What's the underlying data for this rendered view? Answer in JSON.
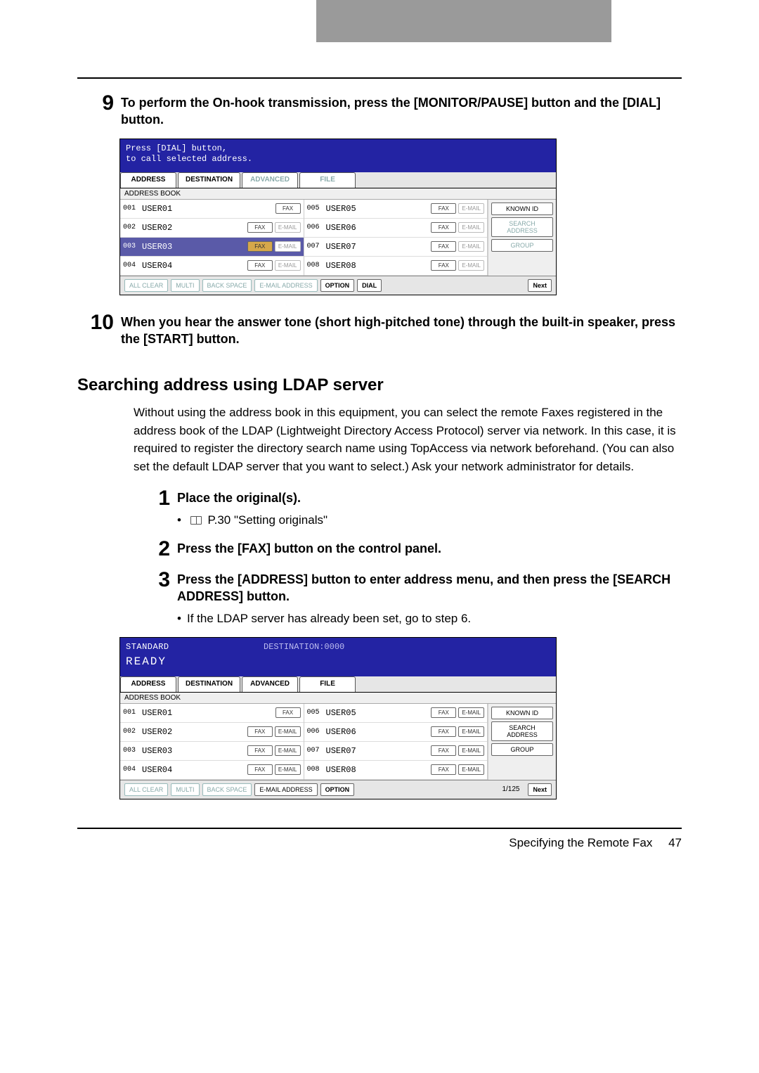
{
  "step9": {
    "number": "9",
    "title": "To perform the On-hook transmission, press the [MONITOR/PAUSE] button and the [DIAL] button."
  },
  "panel1": {
    "status_line1": "Press [DIAL] button,",
    "status_line2": "to call selected address.",
    "tabs": {
      "address": "ADDRESS",
      "destination": "DESTINATION",
      "advanced": "ADVANCED",
      "file": "FILE"
    },
    "sublabel": "ADDRESS BOOK",
    "left_rows": [
      {
        "id": "001",
        "name": "USER01",
        "fax": "FAX",
        "email": ""
      },
      {
        "id": "002",
        "name": "USER02",
        "fax": "FAX",
        "email": "E-MAIL"
      },
      {
        "id": "003",
        "name": "USER03",
        "fax": "FAX",
        "email": "E-MAIL",
        "selected": true
      },
      {
        "id": "004",
        "name": "USER04",
        "fax": "FAX",
        "email": "E-MAIL"
      }
    ],
    "right_rows": [
      {
        "id": "005",
        "name": "USER05",
        "fax": "FAX",
        "email": "E-MAIL"
      },
      {
        "id": "006",
        "name": "USER06",
        "fax": "FAX",
        "email": "E-MAIL"
      },
      {
        "id": "007",
        "name": "USER07",
        "fax": "FAX",
        "email": "E-MAIL"
      },
      {
        "id": "008",
        "name": "USER08",
        "fax": "FAX",
        "email": "E-MAIL"
      }
    ],
    "side": {
      "known_id": "KNOWN ID",
      "search_address": "SEARCH ADDRESS",
      "group": "GROUP"
    },
    "bottom": {
      "all_clear": "ALL CLEAR",
      "multi": "MULTI",
      "back_space": "BACK SPACE",
      "email_addr": "E-MAIL ADDRESS",
      "option": "OPTION",
      "dial": "DIAL",
      "next": "Next"
    }
  },
  "step10": {
    "number": "10",
    "title": "When you hear the answer tone (short high-pitched tone) through the built-in speaker, press the [START] button."
  },
  "section_title": "Searching address using LDAP server",
  "section_body": "Without using the address book in this equipment, you can select the remote Faxes registered in the address book of the LDAP (Lightweight Directory Access Protocol) server via network. In this case, it is required to register the directory search name using TopAccess via network beforehand. (You can also set the default LDAP server that you want to select.) Ask your network administrator for details.",
  "step1": {
    "number": "1",
    "title": "Place the original(s).",
    "ref": "P.30 \"Setting originals\""
  },
  "step2": {
    "number": "2",
    "title": "Press the [FAX] button on the control panel."
  },
  "step3": {
    "number": "3",
    "title": "Press the [ADDRESS] button to enter address menu, and then press the [SEARCH ADDRESS] button.",
    "sub": "If the LDAP server has already been set, go to step 6."
  },
  "panel2": {
    "status_standard": "STANDARD",
    "status_dest": "DESTINATION:0000",
    "status_ready": "READY",
    "tabs": {
      "address": "ADDRESS",
      "destination": "DESTINATION",
      "advanced": "ADVANCED",
      "file": "FILE"
    },
    "sublabel": "ADDRESS BOOK",
    "left_rows": [
      {
        "id": "001",
        "name": "USER01",
        "fax": "FAX",
        "email": ""
      },
      {
        "id": "002",
        "name": "USER02",
        "fax": "FAX",
        "email": "E-MAIL"
      },
      {
        "id": "003",
        "name": "USER03",
        "fax": "FAX",
        "email": "E-MAIL"
      },
      {
        "id": "004",
        "name": "USER04",
        "fax": "FAX",
        "email": "E-MAIL"
      }
    ],
    "right_rows": [
      {
        "id": "005",
        "name": "USER05",
        "fax": "FAX",
        "email": "E-MAIL"
      },
      {
        "id": "006",
        "name": "USER06",
        "fax": "FAX",
        "email": "E-MAIL"
      },
      {
        "id": "007",
        "name": "USER07",
        "fax": "FAX",
        "email": "E-MAIL"
      },
      {
        "id": "008",
        "name": "USER08",
        "fax": "FAX",
        "email": "E-MAIL"
      }
    ],
    "side": {
      "known_id": "KNOWN ID",
      "search_address": "SEARCH ADDRESS",
      "group": "GROUP"
    },
    "bottom": {
      "all_clear": "ALL CLEAR",
      "multi": "MULTI",
      "back_space": "BACK SPACE",
      "email_addr": "E-MAIL ADDRESS",
      "option": "OPTION",
      "page": "1/125",
      "next": "Next"
    }
  },
  "footer": {
    "label": "Specifying the Remote Fax",
    "page": "47"
  }
}
